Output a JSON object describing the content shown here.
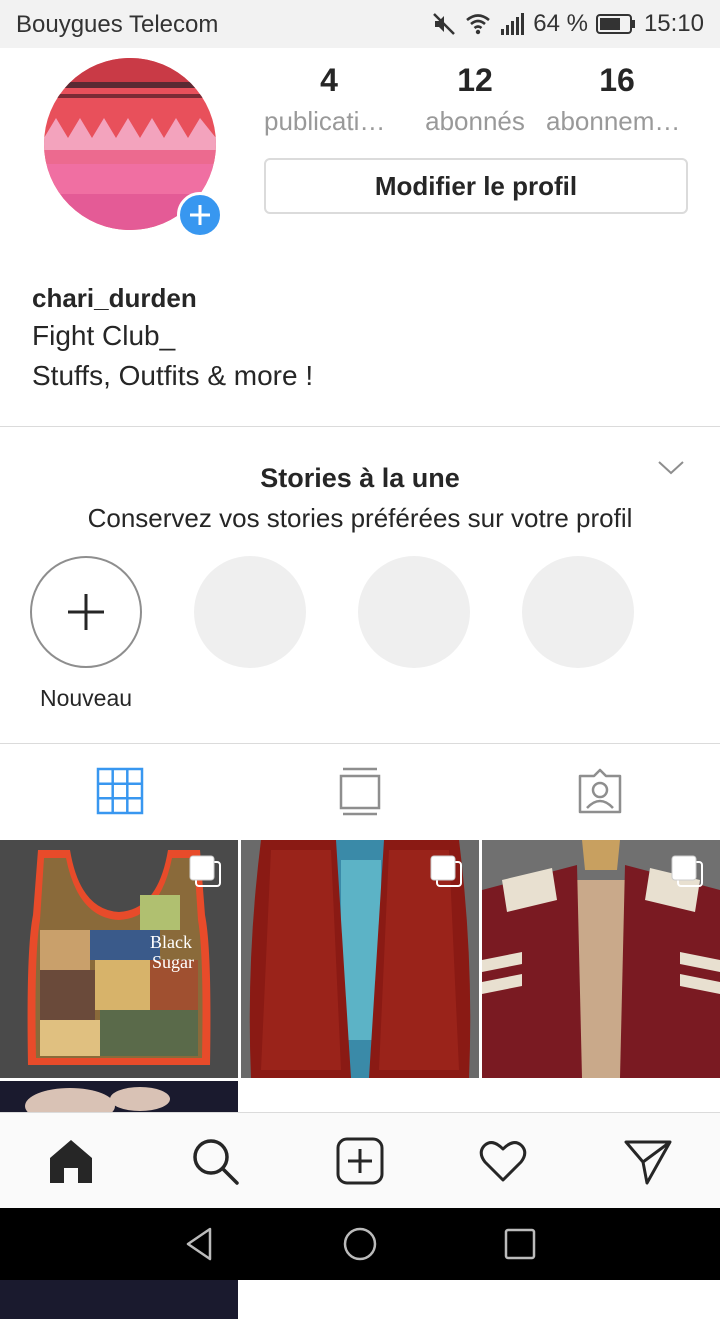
{
  "status_bar": {
    "carrier": "Bouygues Telecom",
    "battery": "64 %",
    "time": "15:10",
    "icons": [
      "mute-icon",
      "wifi-icon",
      "signal-icon",
      "battery-icon"
    ]
  },
  "profile": {
    "stats": [
      {
        "count": "4",
        "label": "publications"
      },
      {
        "count": "12",
        "label": "abonnés"
      },
      {
        "count": "16",
        "label": "abonnements"
      }
    ],
    "edit_button": "Modifier le profil",
    "username": "chari_durden",
    "bio_lines": [
      "Fight Club_",
      "Stuffs, Outfits & more !"
    ]
  },
  "highlights": {
    "title": "Stories à la une",
    "subtitle": "Conservez vos stories préférées sur votre profil",
    "new_label": "Nouveau"
  },
  "tabs": [
    {
      "icon": "grid-icon",
      "active": true
    },
    {
      "icon": "feed-icon",
      "active": false
    },
    {
      "icon": "tagged-icon",
      "active": false
    }
  ],
  "posts": [
    {
      "description": "collage tank top",
      "multiple": true
    },
    {
      "description": "red leather jacket",
      "multiple": true
    },
    {
      "description": "maroon jacket with white stripes",
      "multiple": true
    },
    {
      "description": "hand photo",
      "multiple": false
    }
  ],
  "bottom_nav": [
    "home-icon",
    "search-icon",
    "add-post-icon",
    "heart-icon",
    "direct-icon"
  ],
  "colors": {
    "accent": "#3897f0",
    "divider": "#dbdbdb",
    "muted": "#999999"
  }
}
